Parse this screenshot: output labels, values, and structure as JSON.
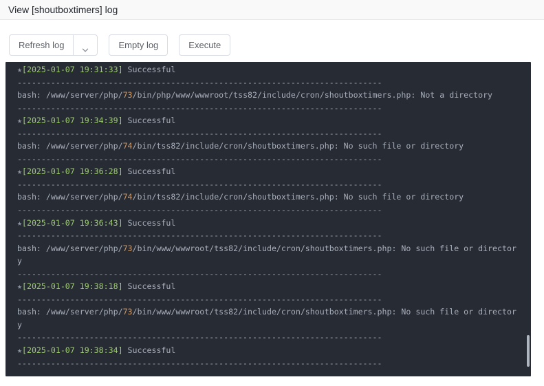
{
  "header": {
    "title": "View [shoutboxtimers] log"
  },
  "toolbar": {
    "refresh_label": "Refresh log",
    "refresh_dropdown_icon": "chevron-down-icon",
    "empty_label": "Empty log",
    "execute_label": "Execute"
  },
  "log": {
    "star_icon": "★",
    "separator": "----------------------------------------------------------------------------",
    "entries": [
      {
        "timestamp": "2025-01-07 19:31:33",
        "status": "Successful",
        "output": {
          "prefix": "bash: /www/server/php/",
          "php_version": "73",
          "suffix": "/bin/php/www/wwwroot/tss82/include/cron/shoutboxtimers.php: Not a directory"
        }
      },
      {
        "timestamp": "2025-01-07 19:34:39",
        "status": "Successful",
        "output": {
          "prefix": "bash: /www/server/php/",
          "php_version": "74",
          "suffix": "/bin/tss82/include/cron/shoutboxtimers.php: No such file or directory"
        }
      },
      {
        "timestamp": "2025-01-07 19:36:28",
        "status": "Successful",
        "output": {
          "prefix": "bash: /www/server/php/",
          "php_version": "74",
          "suffix": "/bin/tss82/include/cron/shoutboxtimers.php: No such file or directory"
        }
      },
      {
        "timestamp": "2025-01-07 19:36:43",
        "status": "Successful",
        "output": {
          "prefix": "bash: /www/server/php/",
          "php_version": "73",
          "suffix": "/bin/www/wwwroot/tss82/include/cron/shoutboxtimers.php: No such file or directory"
        }
      },
      {
        "timestamp": "2025-01-07 19:38:18",
        "status": "Successful",
        "output": {
          "prefix": "bash: /www/server/php/",
          "php_version": "73",
          "suffix": "/bin/www/wwwroot/tss82/include/cron/shoutboxtimers.php: No such file or directory"
        }
      },
      {
        "timestamp": "2025-01-07 19:38:34",
        "status": "Successful",
        "output": null
      }
    ]
  },
  "colors": {
    "log_background": "#272b33",
    "log_text": "#a8afbb",
    "timestamp_green": "#9ecb72",
    "php_version_orange": "#d19a66",
    "star_gray": "#8d95a4",
    "button_border": "#d9dce3",
    "button_text": "#5a5e66",
    "header_background": "#f9f9fa"
  }
}
